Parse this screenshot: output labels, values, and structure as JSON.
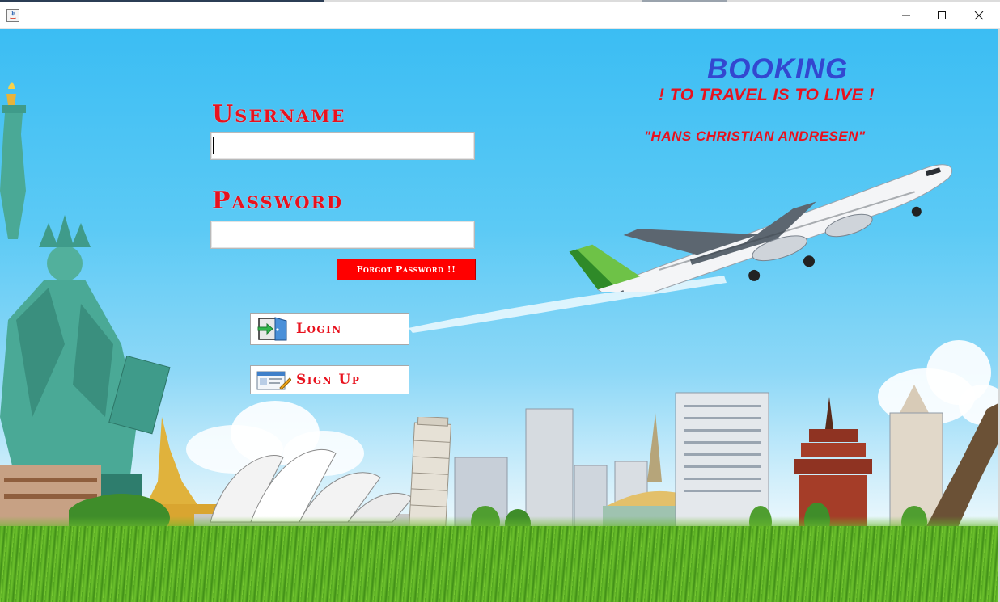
{
  "window": {
    "title": "",
    "icons": {
      "app": "java-app-icon",
      "minimize": "minimize-icon",
      "maximize": "maximize-icon",
      "close": "close-icon"
    }
  },
  "form": {
    "username_label": "Username",
    "username_value": "",
    "password_label": "Password",
    "password_value": "",
    "forgot_label": "Forgot Password !!",
    "login_label": "Login",
    "signup_label": "Sign Up"
  },
  "header": {
    "brand": "BOOKING",
    "tagline": "! TO TRAVEL IS TO LIVE !",
    "quote": "\"HANS CHRISTIAN ANDRESEN\""
  },
  "colors": {
    "accent_red": "#e8121e",
    "brand_blue": "#3347d0",
    "forgot_bg": "#ff0000",
    "sky": "#3bbdf3",
    "grass": "#5fb227"
  }
}
